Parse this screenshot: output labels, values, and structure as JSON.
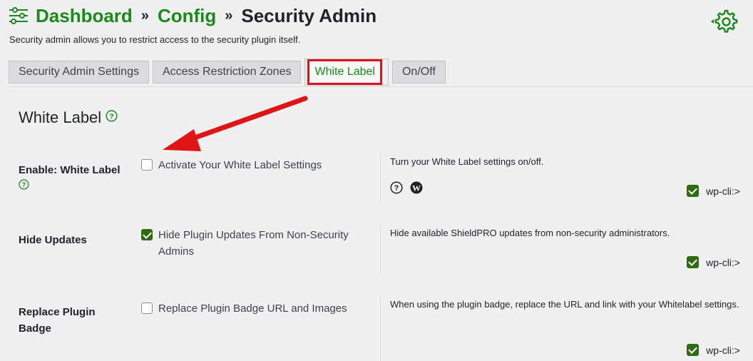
{
  "breadcrumb": {
    "dashboard": "Dashboard",
    "config": "Config",
    "current": "Security Admin",
    "separator": "»"
  },
  "subtitle": "Security admin allows you to restrict access to the security plugin itself.",
  "tabs": [
    {
      "label": "Security Admin Settings",
      "active": false
    },
    {
      "label": "Access Restriction Zones",
      "active": false
    },
    {
      "label": "White Label",
      "active": true
    },
    {
      "label": "On/Off",
      "active": false
    }
  ],
  "section": {
    "title": "White Label"
  },
  "rows": [
    {
      "label": "Enable: White Label",
      "option": "Activate Your White Label Settings",
      "checked": false,
      "description": "Turn your White Label settings on/off.",
      "wpcli": "wp-cli:>"
    },
    {
      "label": "Hide Updates",
      "option": "Hide Plugin Updates From Non-Security Admins",
      "checked": true,
      "description": "Hide available ShieldPRO updates from non-security administrators.",
      "wpcli": "wp-cli:>"
    },
    {
      "label": "Replace Plugin Badge",
      "option": "Replace Plugin Badge URL and Images",
      "checked": false,
      "description": "When using the plugin badge, replace the URL and link with your Whitelabel settings.",
      "wpcli": "wp-cli:>"
    }
  ],
  "colors": {
    "accent": "#1a8a1a",
    "highlight": "#e01414",
    "checkbox": "#2e6b12"
  }
}
